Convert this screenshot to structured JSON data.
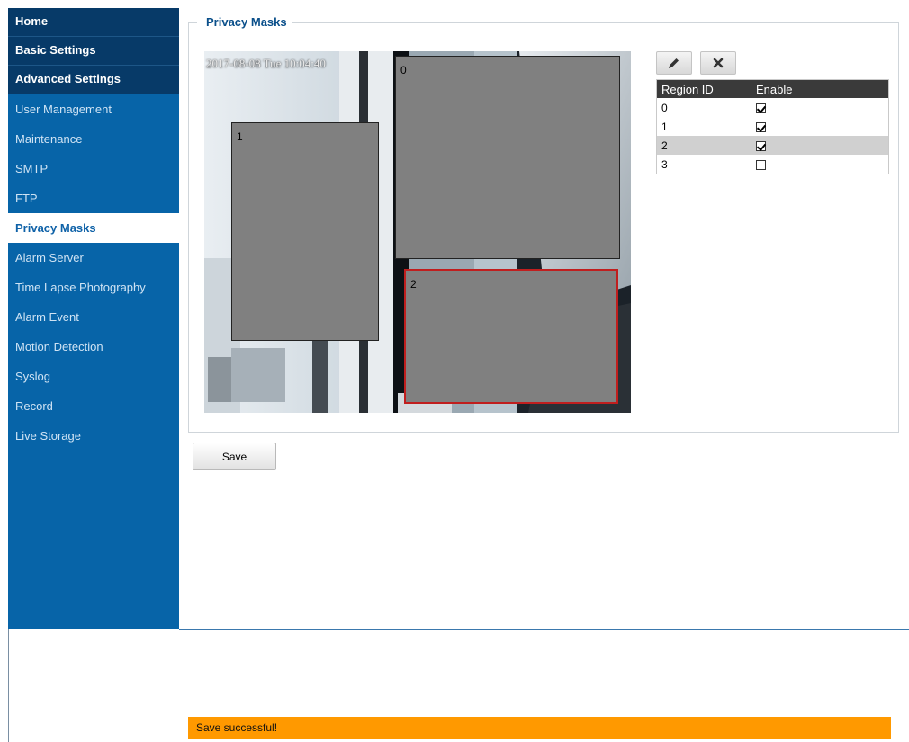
{
  "sidebar": {
    "main_items": [
      {
        "label": "Home"
      },
      {
        "label": "Basic Settings"
      },
      {
        "label": "Advanced Settings"
      }
    ],
    "sub_items": [
      {
        "label": "User Management"
      },
      {
        "label": "Maintenance"
      },
      {
        "label": "SMTP"
      },
      {
        "label": "FTP"
      },
      {
        "label": "Privacy Masks",
        "active": true
      },
      {
        "label": "Alarm Server"
      },
      {
        "label": "Time Lapse Photography"
      },
      {
        "label": "Alarm Event"
      },
      {
        "label": "Motion Detection"
      },
      {
        "label": "Syslog"
      },
      {
        "label": "Record"
      },
      {
        "label": "Live Storage"
      }
    ]
  },
  "section": {
    "title": "Privacy Masks"
  },
  "camera": {
    "timestamp": "2017-08-08 Tue 10:04:40",
    "masks": [
      {
        "label": "0"
      },
      {
        "label": "1"
      },
      {
        "label": "2",
        "selected": true
      }
    ]
  },
  "toolbar": {
    "edit_icon": "pencil-icon",
    "delete_icon": "close-icon"
  },
  "region_table": {
    "headers": {
      "region_id": "Region ID",
      "enable": "Enable"
    },
    "rows": [
      {
        "id": "0",
        "enabled": true
      },
      {
        "id": "1",
        "enabled": true
      },
      {
        "id": "2",
        "enabled": true,
        "selected": true
      },
      {
        "id": "3",
        "enabled": false
      }
    ]
  },
  "save_button": {
    "label": "Save"
  },
  "status": {
    "message": "Save successful!",
    "color": "#ff9900"
  },
  "colors": {
    "sidebar": "#0764a8",
    "sidebar_main": "#073a68",
    "mask": "#808080",
    "mask_selected_border": "#c01e1e"
  }
}
